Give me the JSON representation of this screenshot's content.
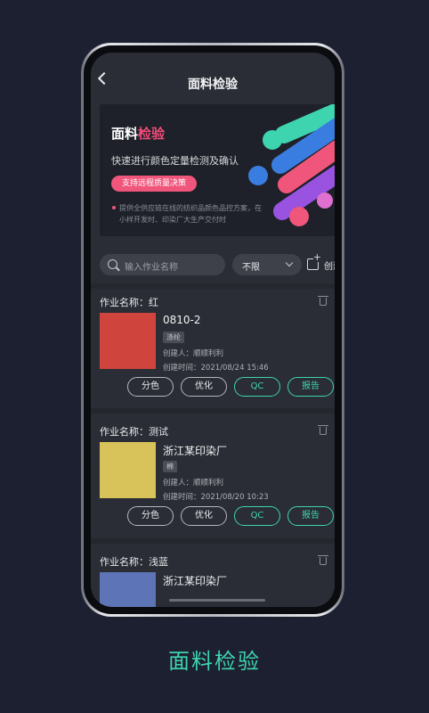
{
  "nav": {
    "title": "面料检验"
  },
  "banner": {
    "title_plain": "面料",
    "title_highlight": "检验",
    "subtitle": "快速进行颜色定量检测及确认",
    "button_label": "支持远程质量决策",
    "description": "提供全供应链在线的纺织品颜色品控方案，在小样开发时、印染厂大生产交付时"
  },
  "toolbar": {
    "search_placeholder": "输入作业名称",
    "filter_value": "不限",
    "create_label": "创建"
  },
  "jobs": [
    {
      "name": "作业名称：红",
      "code": "0810-2",
      "tag": "涤纶",
      "creator": "创建人：顺顺利利",
      "created_at": "创建时间：2021/08/24 15:46",
      "swatch_color": "#d0443e",
      "actions": [
        "分色",
        "优化",
        "QC",
        "报告"
      ]
    },
    {
      "name": "作业名称：测试",
      "code": "浙江某印染厂",
      "tag": "棉",
      "creator": "创建人：顺顺利利",
      "created_at": "创建时间：2021/08/20 10:23",
      "swatch_color": "#d8c35a",
      "actions": [
        "分色",
        "优化",
        "QC",
        "报告"
      ]
    },
    {
      "name": "作业名称：浅蓝",
      "code": "浙江某印染厂",
      "swatch_color": "#5d74b6"
    }
  ],
  "caption": "面料检验",
  "colors": {
    "accent": "#3ed4b0",
    "brand_pink": "#f0567c",
    "background": "#1c2030"
  }
}
